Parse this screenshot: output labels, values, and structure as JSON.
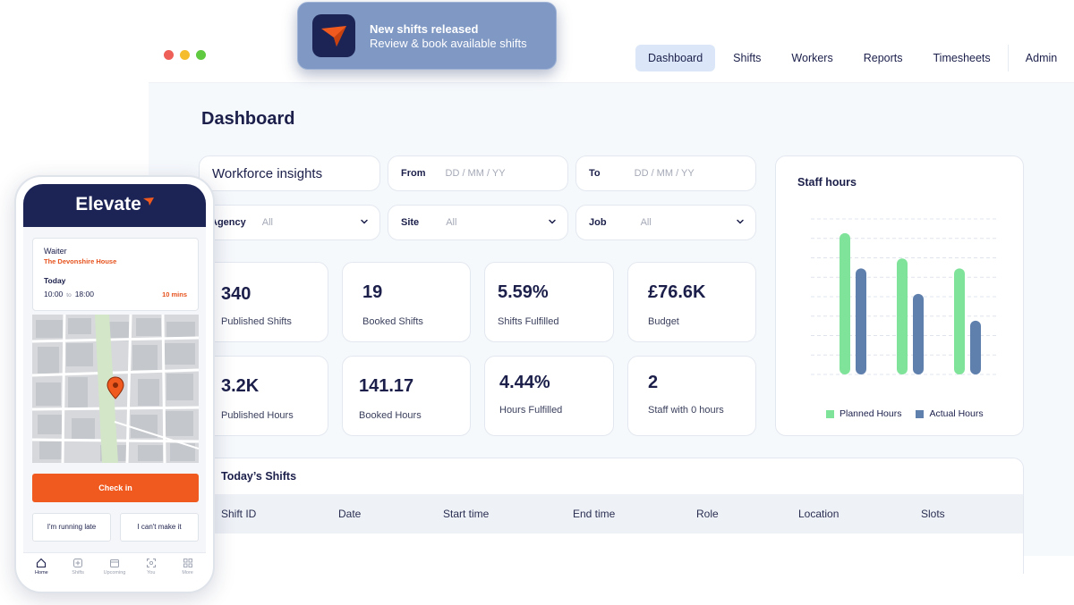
{
  "notification": {
    "title": "New shifts released",
    "body": "Review & book available shifts"
  },
  "window": {
    "traffic_colors": [
      "#ee5f57",
      "#f5bd2e",
      "#5fc93f"
    ]
  },
  "nav": {
    "tabs": [
      {
        "label": "Dashboard",
        "active": true
      },
      {
        "label": "Shifts",
        "active": false
      },
      {
        "label": "Workers",
        "active": false
      },
      {
        "label": "Reports",
        "active": false
      },
      {
        "label": "Timesheets",
        "active": false
      }
    ],
    "user": "Admin"
  },
  "page": {
    "title": "Dashboard"
  },
  "filters": {
    "insights": "Workforce insights",
    "from_label": "From",
    "from_placeholder": "DD / MM / YY",
    "to_label": "To",
    "to_placeholder": "DD / MM / YY",
    "agency_label": "Agency",
    "agency_value": "All",
    "site_label": "Site",
    "site_value": "All",
    "job_label": "Job",
    "job_value": "All"
  },
  "stats": [
    {
      "value": "340",
      "label": "Published Shifts"
    },
    {
      "value": "19",
      "label": "Booked Shifts"
    },
    {
      "value": "5.59%",
      "label": "Shifts Fulfilled"
    },
    {
      "value": "£76.6K",
      "label": "Budget"
    },
    {
      "value": "3.2K",
      "label": "Published Hours"
    },
    {
      "value": "141.17",
      "label": "Booked Hours"
    },
    {
      "value": "4.44%",
      "label": "Hours Fulfilled"
    },
    {
      "value": "2",
      "label": "Staff with 0 hours"
    }
  ],
  "staff_hours": {
    "title": "Staff hours",
    "colors": {
      "planned": "#7fe39a",
      "actual": "#5f7fad"
    },
    "chart_data": {
      "type": "bar",
      "title": "Staff hours",
      "categories": [
        "",
        "",
        ""
      ],
      "series": [
        {
          "name": "Planned Hours",
          "values": [
            100,
            82,
            75
          ]
        },
        {
          "name": "Actual Hours",
          "values": [
            75,
            57,
            38
          ]
        }
      ],
      "ylim": [
        0,
        110
      ],
      "grid": true,
      "legend": "bottom"
    }
  },
  "todays_shifts": {
    "title": "Today’s Shifts",
    "columns": [
      "Shift ID",
      "Date",
      "Start time",
      "End time",
      "Role",
      "Location",
      "Slots"
    ]
  },
  "phone": {
    "brand": "Elevate",
    "job": {
      "role": "Waiter",
      "location": "The Devonshire House",
      "day": "Today",
      "start": "10:00",
      "to": "to",
      "end": "18:00",
      "eta": "10 mins"
    },
    "check_in": "Check in",
    "running_late": "I'm running late",
    "cant_make_it": "I can't make it",
    "tabs": [
      {
        "label": "Home",
        "icon": "home-icon",
        "active": true
      },
      {
        "label": "Shifts",
        "icon": "plus-square-icon",
        "active": false
      },
      {
        "label": "Upcoming",
        "icon": "calendar-icon",
        "active": false
      },
      {
        "label": "You",
        "icon": "face-scan-icon",
        "active": false
      },
      {
        "label": "More",
        "icon": "grid-icon",
        "active": false
      }
    ]
  }
}
